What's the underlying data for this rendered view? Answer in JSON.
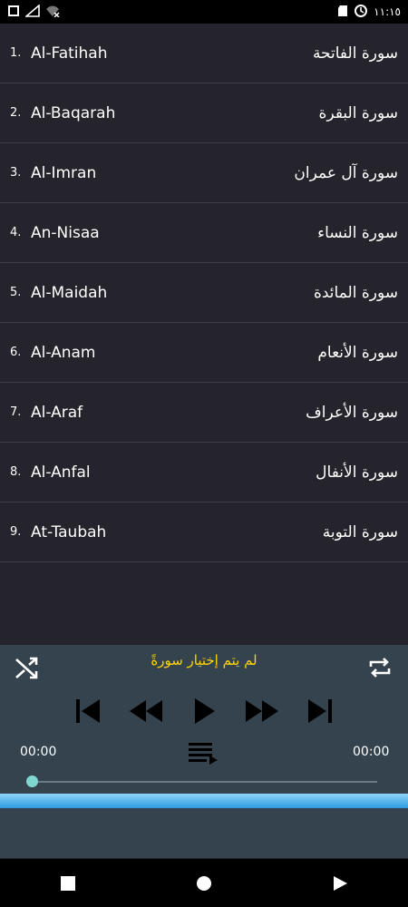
{
  "status_bar": {
    "time": "١١:١٥",
    "left_icons": [
      "notification-icon",
      "signal-icon",
      "wifi-off-icon"
    ],
    "right_icons": [
      "sd-card-icon",
      "data-saver-icon"
    ]
  },
  "surah_list": [
    {
      "number": "1.",
      "english": "Al-Fatihah",
      "arabic": "سورة الفاتحة"
    },
    {
      "number": "2.",
      "english": "Al-Baqarah",
      "arabic": "سورة البقرة"
    },
    {
      "number": "3.",
      "english": "Al-Imran",
      "arabic": "سورة آل عمران"
    },
    {
      "number": "4.",
      "english": "An-Nisaa",
      "arabic": "سورة النساء"
    },
    {
      "number": "5.",
      "english": "Al-Maidah",
      "arabic": "سورة المائدة"
    },
    {
      "number": "6.",
      "english": "Al-Anam",
      "arabic": "سورة الأنعام"
    },
    {
      "number": "7.",
      "english": "Al-Araf",
      "arabic": "سورة الأعراف"
    },
    {
      "number": "8.",
      "english": "Al-Anfal",
      "arabic": "سورة الأنفال"
    },
    {
      "number": "9.",
      "english": "At-Taubah",
      "arabic": "سورة التوبة"
    }
  ],
  "player": {
    "now_playing": "لم يتم إختيار سورةً",
    "current_time": "00:00",
    "total_time": "00:00",
    "progress": 0,
    "accent_color": "#7fd8d0",
    "title_color": "#ffd700"
  },
  "nav_bar": {
    "icons": [
      "recents-icon",
      "home-icon",
      "back-icon"
    ]
  }
}
